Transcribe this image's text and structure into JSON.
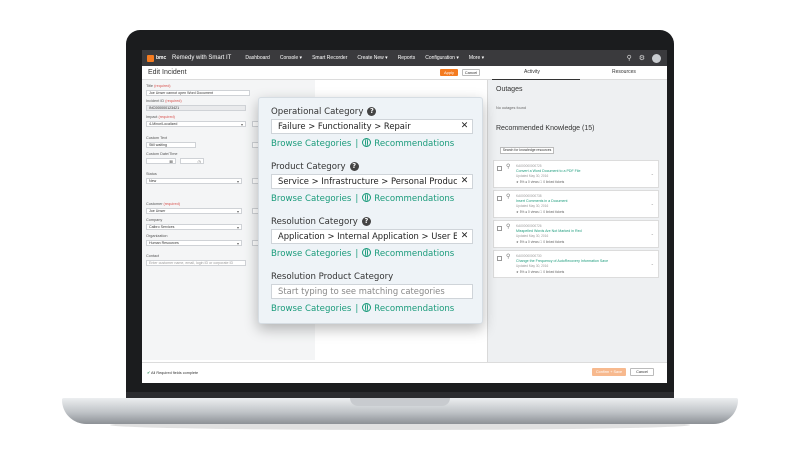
{
  "nav": {
    "logo": "bmc",
    "app_title": "Remedy with Smart IT",
    "items": [
      "Dashboard",
      "Console ▾",
      "Smart Recorder",
      "Create New ▾",
      "Reports",
      "Configuration ▾",
      "More ▾"
    ]
  },
  "header": {
    "title": "Edit Incident",
    "apply": "Apply",
    "cancel": "Cancel",
    "tabs": [
      "Activity",
      "Resources"
    ]
  },
  "form": {
    "title_label": "Title",
    "required": "(required)",
    "title_value": "Joe Unser cannot open Word Document",
    "incident_id_label": "Incident ID",
    "incident_id_value": "INC000000123421",
    "impact_label": "Impact",
    "impact_value": "4-Minor/Localized",
    "custom_text_label": "Custom Text",
    "custom_text_value": "Still waiting",
    "custom_date_label": "Custom Date/Time",
    "status_label": "Status",
    "status_value": "New",
    "customer_label": "Customer",
    "customer_value": "Joe Unser",
    "company_label": "Company",
    "company_value": "Calbro Services",
    "organization_label": "Organization",
    "organization_value": "Human Resources",
    "contact_label": "Contact",
    "contact_placeholder": "Enter customer name, email, login ID or corporate ID"
  },
  "categories": {
    "operational_label": "Operational Category",
    "operational_value": "Failure > Functionality > Repair",
    "product_label": "Product Category",
    "product_value": "Service > Infrastructure > Personal Productivity",
    "resolution_label": "Resolution Category",
    "resolution_value": "Application > Internal Application > User Education",
    "resolution_product_label": "Resolution Product Category",
    "resolution_product_placeholder": "Start typing to see matching categories",
    "browse": "Browse Categories",
    "separator": "|",
    "recommendations": "Recommendations",
    "clear": "✕",
    "help": "?"
  },
  "right": {
    "outages_title": "Outages",
    "outages_none": "No outages found",
    "knowledge_title": "Recommended Knowledge (15)",
    "search_button": "Search for knowledge resources",
    "kb": [
      {
        "id": "KA000000000725",
        "title": "Convert a Word Document to a PDF File",
        "updated": "Updated May 30, 2016",
        "stats": "★ 5%     ● 0 views     ☐ 0 linked tickets"
      },
      {
        "id": "KA000000000738",
        "title": "Insert Comments in a Document",
        "updated": "Updated May 30, 2016",
        "stats": "★ 5%     ● 0 views     ☐ 0 linked tickets"
      },
      {
        "id": "KA000000000726",
        "title": "Misspelled Words Are Not Marked in Red",
        "updated": "Updated May 30, 2016",
        "stats": "★ 5%     ● 0 views     ☐ 0 linked tickets"
      },
      {
        "id": "KA000000000730",
        "title": "Change the Frequency of AutoRecovery Information Save",
        "updated": "Updated May 30, 2016",
        "stats": "★ 5%     ● 0 views     ☐ 0 linked tickets"
      }
    ]
  },
  "footer": {
    "status": "All Required fields complete",
    "confirm": "Confirm + Save",
    "cancel": "Cancel"
  },
  "colors": {
    "accent": "#f47b20",
    "link": "#1a9b7b",
    "nav_bg": "#3a3a3d"
  }
}
